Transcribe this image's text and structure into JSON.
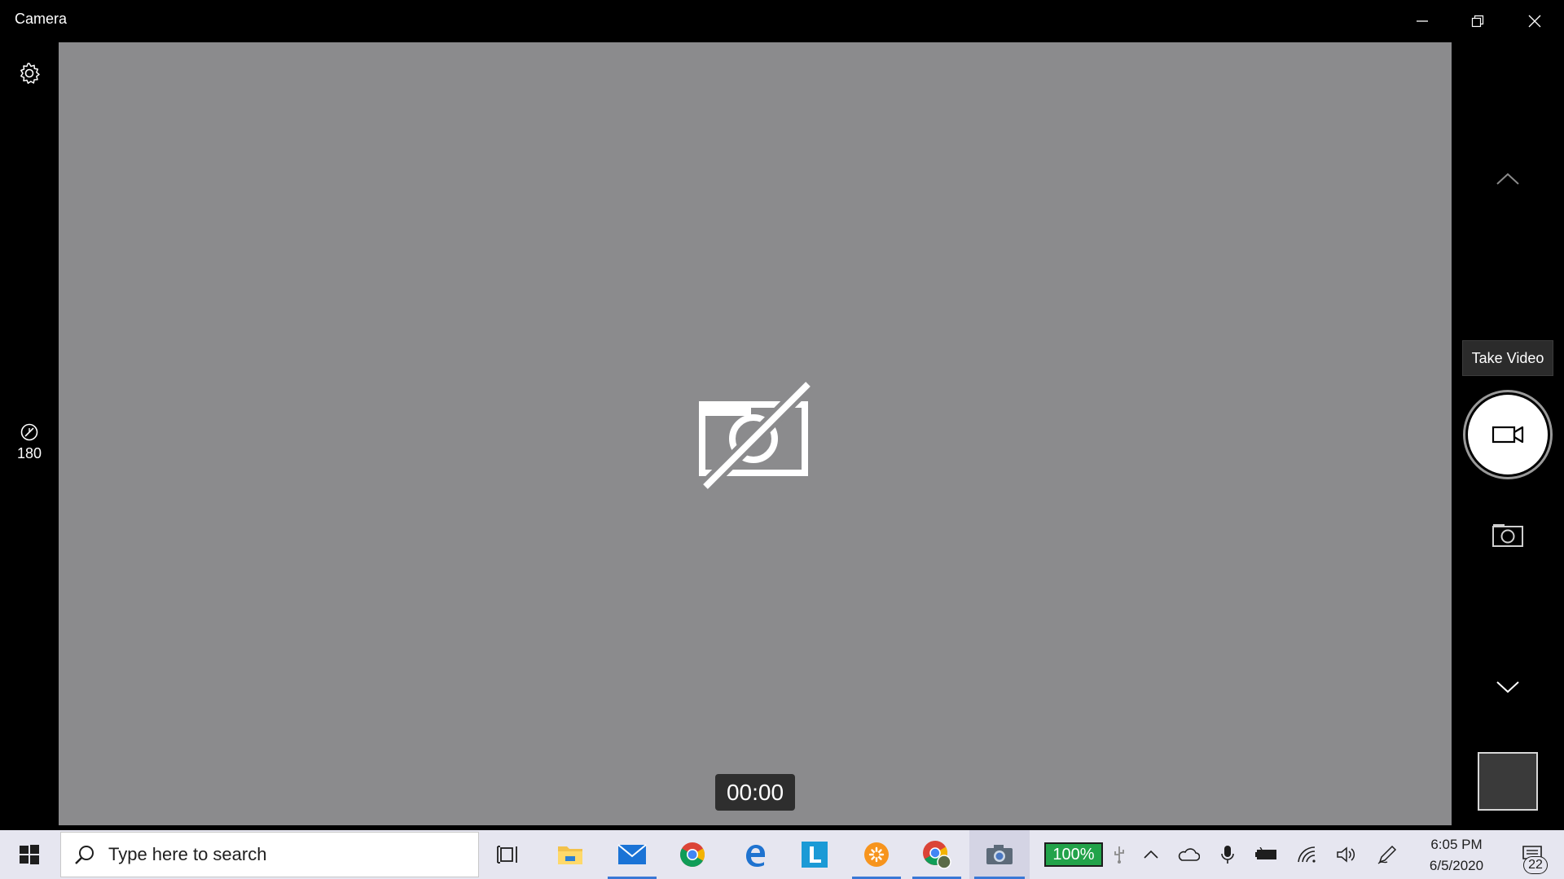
{
  "window": {
    "title": "Camera",
    "controls": [
      "minimize-icon",
      "restore-icon",
      "close-icon"
    ]
  },
  "left_rail": {
    "settings_icon": "gear-icon",
    "timer_setting": {
      "icon": "self-timer-icon",
      "label": "180"
    }
  },
  "viewport": {
    "status_icon": "camera-disabled-icon",
    "recording_time": "00:00"
  },
  "right_rail": {
    "tooltip": "Take Video",
    "capture_mode": "video",
    "icons": [
      "chevron-up-icon",
      "video-camera-icon",
      "photo-camera-icon",
      "chevron-down-icon"
    ],
    "thumbnail_color": "#3a3a3a"
  },
  "taskbar": {
    "search_placeholder": "Type here to search",
    "apps": [
      {
        "name": "task-view-icon",
        "running": false
      },
      {
        "name": "file-explorer-icon",
        "running": false
      },
      {
        "name": "mail-icon",
        "running": true
      },
      {
        "name": "chrome-icon",
        "running": false
      },
      {
        "name": "edge-icon",
        "running": false
      },
      {
        "name": "l-app-icon",
        "running": false
      },
      {
        "name": "orange-app-icon",
        "running": true
      },
      {
        "name": "chrome-profile-icon",
        "running": true
      },
      {
        "name": "camera-app-icon",
        "running": true,
        "active": true
      }
    ],
    "battery_percent": "100%",
    "tray_icons": [
      "usb-icon",
      "chevron-up-icon",
      "onedrive-icon",
      "microphone-icon",
      "battery-icon",
      "wifi-icon",
      "volume-icon",
      "pen-icon"
    ],
    "time": "6:05 PM",
    "date": "6/5/2020",
    "notification_count": "22"
  },
  "colors": {
    "viewport_bg": "#8b8b8d",
    "taskbar_bg": "#e6e6f0",
    "battery_green": "#22a34a",
    "accent_blue": "#3a78d6"
  }
}
